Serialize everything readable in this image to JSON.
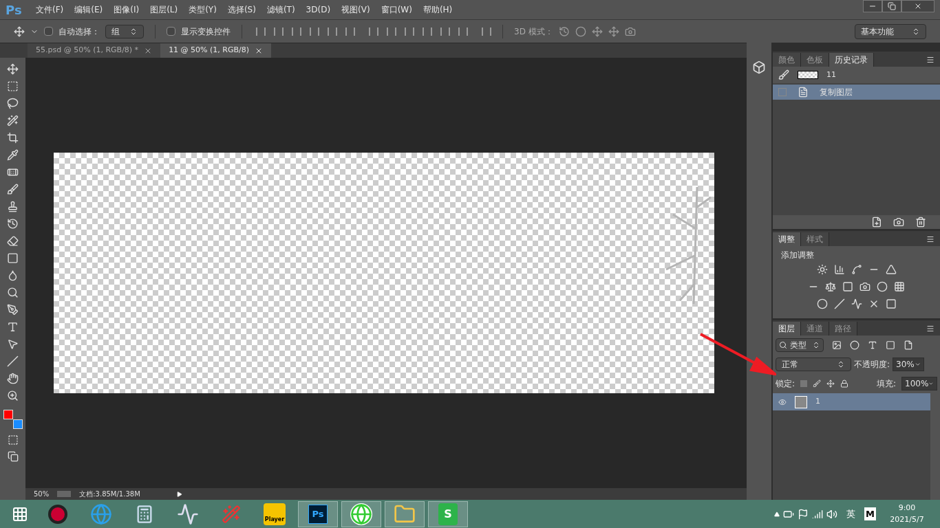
{
  "app": {
    "logo": "Ps"
  },
  "menu": [
    "文件(F)",
    "编辑(E)",
    "图像(I)",
    "图层(L)",
    "类型(Y)",
    "选择(S)",
    "滤镜(T)",
    "3D(D)",
    "视图(V)",
    "窗口(W)",
    "帮助(H)"
  ],
  "options_bar": {
    "auto_select": {
      "label": "自动选择：",
      "checked": false
    },
    "target": "组",
    "show_transform": {
      "label": "显示变换控件",
      "checked": false
    },
    "mode_3d_label": "3D 模式：",
    "workspace": "基本功能"
  },
  "document_tabs": [
    {
      "title": "55.psd @ 50% (1, RGB/8) *",
      "selected": false
    },
    {
      "title": "11 @ 50% (1, RGB/8)",
      "selected": true
    }
  ],
  "swatches": [
    {
      "color": "#ff0000"
    },
    {
      "color": "#1a8cff"
    }
  ],
  "history_panel": {
    "tabs": [
      {
        "label": "颜色",
        "selected": false
      },
      {
        "label": "色板",
        "selected": false
      },
      {
        "label": "历史记录",
        "selected": true
      }
    ],
    "snapshot": "11",
    "items": [
      {
        "label": "复制图层",
        "selected": true
      }
    ]
  },
  "adjustments_panel": {
    "tabs": [
      {
        "label": "调整",
        "selected": true
      },
      {
        "label": "样式",
        "selected": false
      }
    ],
    "heading": "添加调整"
  },
  "layers_panel": {
    "tabs": [
      {
        "label": "图层",
        "selected": true
      },
      {
        "label": "通道",
        "selected": false
      },
      {
        "label": "路径",
        "selected": false
      }
    ],
    "filter": "类型",
    "blend_mode": "正常",
    "opacity_label": "不透明度:",
    "opacity": "30%",
    "lock_label": "锁定:",
    "fill_label": "填充:",
    "fill": "100%",
    "layers": [
      {
        "name": "1",
        "visible": true,
        "selected": true
      }
    ]
  },
  "status_bar": {
    "zoom": "50%",
    "doc_info": "文档:3.85M/1.38M"
  },
  "taskbar": {
    "apps": [
      {
        "kind": "media",
        "running": false
      },
      {
        "kind": "ie",
        "running": false
      },
      {
        "kind": "calc",
        "running": false
      },
      {
        "kind": "monitor",
        "running": false
      },
      {
        "kind": "tool",
        "running": false
      },
      {
        "kind": "player",
        "label": "Player",
        "running": false
      },
      {
        "kind": "ps",
        "label": "Ps",
        "running": true
      },
      {
        "kind": "browser",
        "running": true
      },
      {
        "kind": "folder",
        "running": true
      },
      {
        "kind": "sheet",
        "label": "S",
        "running": true
      }
    ],
    "ime": "英",
    "ime_mode": "M",
    "time": "9:00",
    "date": "2021/5/7"
  }
}
